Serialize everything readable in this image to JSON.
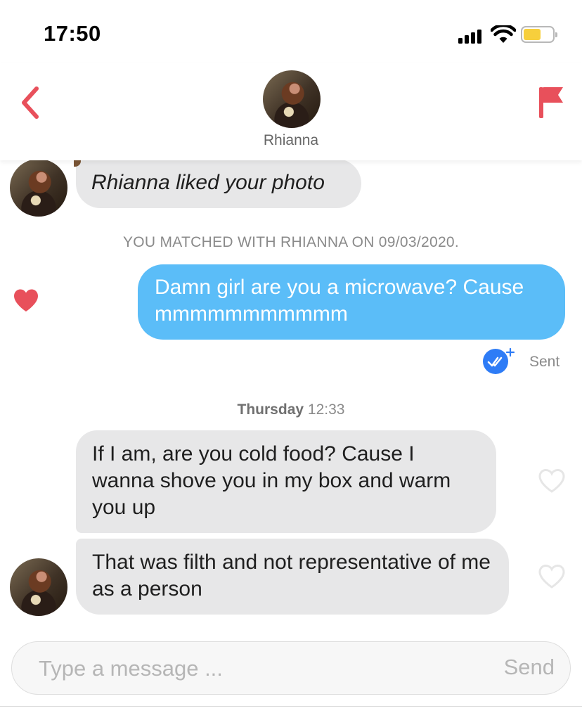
{
  "status_bar": {
    "time": "17:50"
  },
  "header": {
    "name": "Rhianna"
  },
  "conversation": {
    "liked_photo": "Rhianna liked your photo",
    "matched_notice": "YOU MATCHED WITH RHIANNA ON 09/03/2020.",
    "sent_message": "Damn girl are you a microwave? Cause mmmmmmmmmmm",
    "sent_status": "Sent",
    "day_separator": {
      "day": "Thursday",
      "time": "12:33"
    },
    "received_1": "If I am, are you cold food? Cause I wanna shove you in my box and warm you up",
    "received_2": "That was filth and not representative of me as a person"
  },
  "composer": {
    "placeholder": "Type a message ...",
    "send_label": "Send"
  },
  "colors": {
    "accent": "#e8505b",
    "sent_bubble": "#5bbdf8",
    "received_bubble": "#e7e7e8",
    "read_badge": "#2e7cf6"
  },
  "icons": [
    "back-chevron-icon",
    "flag-icon",
    "heart-filled-icon",
    "heart-outline-icon",
    "read-receipt-icon",
    "wifi-icon",
    "signal-icon",
    "battery-icon"
  ]
}
